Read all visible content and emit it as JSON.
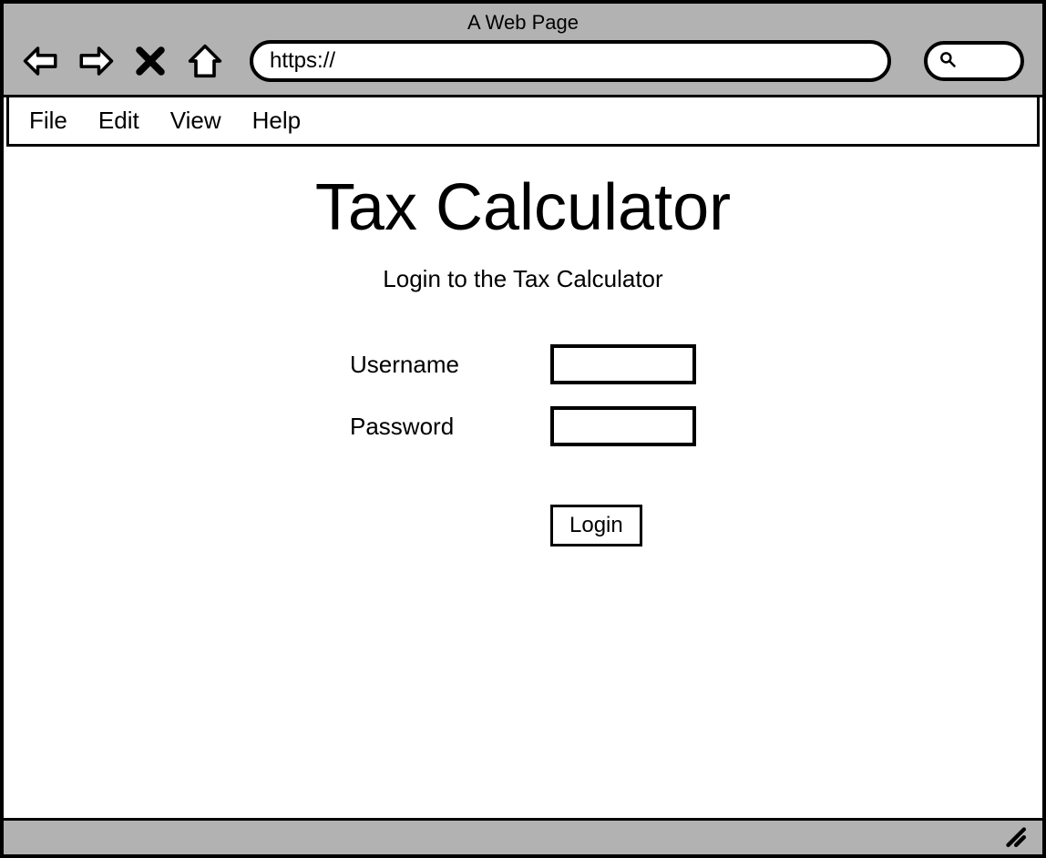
{
  "browser": {
    "title": "A Web Page",
    "url": "https://"
  },
  "menu": {
    "items": [
      "File",
      "Edit",
      "View",
      "Help"
    ]
  },
  "page": {
    "title": "Tax Calculator",
    "subtitle": "Login to the Tax Calculator"
  },
  "form": {
    "username_label": "Username",
    "username_value": "",
    "password_label": "Password",
    "password_value": "",
    "login_label": "Login"
  }
}
